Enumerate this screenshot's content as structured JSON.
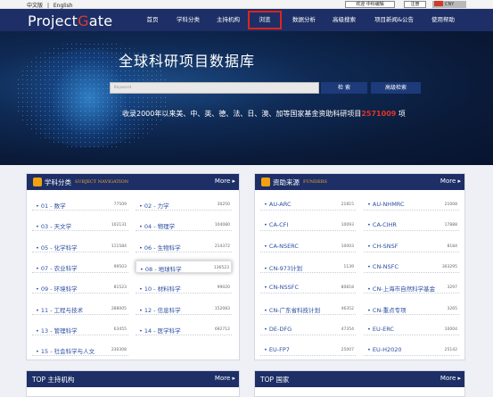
{
  "topbar": {
    "lang_zh": "中文版",
    "sep": "|",
    "lang_en": "English",
    "welcome": "欢迎 中科编辑",
    "register": "注册",
    "flag_label": "CNY"
  },
  "logo": {
    "pre": "Project",
    "g": "G",
    "post": "ate"
  },
  "nav": [
    "首页",
    "学科分类",
    "主持机构",
    "浏览",
    "数据分析",
    "高级搜索",
    "项目新闻&公告",
    "使用帮助"
  ],
  "hero": {
    "title": "全球科研项目数据库",
    "search_placeholder": "Keyword",
    "search_btn": "检 索",
    "adv_btn": "高级检索",
    "stat_pre": "收录2000年以来美、中、英、德、法、日、澳、加等国家基金资助科研项目",
    "stat_num": "2571009",
    "stat_post": "项"
  },
  "subjects": {
    "title": "学科分类",
    "subtitle": "SUBJECT NAVIGATION",
    "more": "More ▸",
    "items": [
      {
        "label": "• 01 - 数学",
        "count": "77509"
      },
      {
        "label": "• 02 - 力学",
        "count": "30250"
      },
      {
        "label": "• 03 - 天文学",
        "count": "102131"
      },
      {
        "label": "• 04 - 物理学",
        "count": "104080"
      },
      {
        "label": "• 05 - 化学科学",
        "count": "111584"
      },
      {
        "label": "• 06 - 生物科学",
        "count": "214372"
      },
      {
        "label": "• 07 - 农业科学",
        "count": "99503"
      },
      {
        "label": "• 08 - 地球科学",
        "count": "136523"
      },
      {
        "label": "• 09 - 环境科学",
        "count": "81523"
      },
      {
        "label": "• 10 - 材料科学",
        "count": "99020"
      },
      {
        "label": "• 11 - 工程与技术",
        "count": "288005"
      },
      {
        "label": "• 12 - 信息科学",
        "count": "152083"
      },
      {
        "label": "• 13 - 管理科学",
        "count": "63455"
      },
      {
        "label": "• 14 - 医学科学",
        "count": "692712"
      },
      {
        "label": "• 15 - 社会科学与人文",
        "count": "230308"
      }
    ]
  },
  "funders": {
    "title": "资助来源",
    "subtitle": "FUNDERS",
    "more": "More ▸",
    "items": [
      {
        "label": "• AU-ARC",
        "count": "21815"
      },
      {
        "label": "• AU-NHMRC",
        "count": "21008"
      },
      {
        "label": "• CA-CFI",
        "count": "10093"
      },
      {
        "label": "• CA-CIHR",
        "count": "17888"
      },
      {
        "label": "• CA-NSERC",
        "count": "10003"
      },
      {
        "label": "• CH-SNSF",
        "count": "8184"
      },
      {
        "label": "• CN-973计划",
        "count": "1139"
      },
      {
        "label": "• CN-NSFC",
        "count": "303295"
      },
      {
        "label": "• CN-NSSFC",
        "count": "80818"
      },
      {
        "label": "• CN-上海市自然科学基金",
        "count": "3297"
      },
      {
        "label": "• CN-广东省科技计划",
        "count": "46352"
      },
      {
        "label": "• CN-重点专项",
        "count": "3265"
      },
      {
        "label": "• DE-DFG",
        "count": "47354"
      },
      {
        "label": "• EU-ERC",
        "count": "10004"
      },
      {
        "label": "• EU-FP7",
        "count": "25007"
      },
      {
        "label": "• EU-H2020",
        "count": "25142"
      }
    ]
  },
  "bottom": {
    "left_title": "TOP 主持机构",
    "right_title": "TOP 国家",
    "more": "More ▸"
  },
  "colors": {
    "nav_bg": "#1d2f66",
    "accent_red": "#e0241b",
    "link_blue": "#2b4ea0",
    "icon_orange": "#f1a20e"
  }
}
